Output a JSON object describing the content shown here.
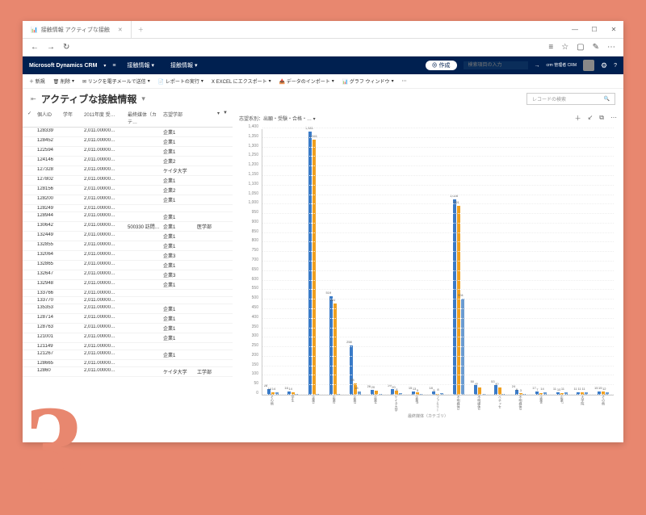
{
  "window": {
    "tab_title": "接触情報 アクティブな接触",
    "minimize": "—",
    "maximize": "☐",
    "close": "✕"
  },
  "addr": {
    "back": "←",
    "forward": "→",
    "reload": "↻",
    "hub": "≡",
    "star": "☆",
    "read": "▢",
    "edit": "✎",
    "more": "⋯"
  },
  "crm": {
    "logo": "Microsoft Dynamics CRM",
    "down": "▾",
    "menu": "≡",
    "nav1": "接触情報",
    "nav2": "接触情報",
    "create": "⊕ 作成",
    "search_ph": "検索項目の入力",
    "search_go": "→",
    "user": "crm 管理者\nCRM",
    "gear": "⚙",
    "help": "?"
  },
  "tb": {
    "new": "＋ 新規",
    "del": "🗑 削除",
    "elink": "✉ リンクを電子メールで送信",
    "report": "📄 レポートの実行",
    "excel": "Ⅹ EXCEL にエクスポート",
    "import": "📥 データのインポート",
    "chart": "📊 グラフ ウィンドウ",
    "more": "⋯"
  },
  "page": {
    "title": "アクティブな接触情報",
    "dd": "▾",
    "search_ph": "レコードの検索"
  },
  "cols": {
    "c1": "個人ID",
    "c2": "学年",
    "c3": "2011年度 受…",
    "c4": "最終媒体（カテ…",
    "c5": "志望学部",
    "dd": "▾",
    "filter": "▼"
  },
  "rows": [
    {
      "id": "128339",
      "y": "",
      "a": "2,011.00000…",
      "b": "",
      "m": "企業1",
      "d": ""
    },
    {
      "id": "128452",
      "y": "",
      "a": "2,011.00000…",
      "b": "",
      "m": "企業1",
      "d": ""
    },
    {
      "id": "122594",
      "y": "",
      "a": "2,011.00000…",
      "b": "",
      "m": "企業1",
      "d": ""
    },
    {
      "id": "124146",
      "y": "",
      "a": "2,011.00000…",
      "b": "",
      "m": "企業2",
      "d": ""
    },
    {
      "id": "127328",
      "y": "",
      "a": "2,011.00000…",
      "b": "",
      "m": "ケイタ大学",
      "d": ""
    },
    {
      "id": "127802",
      "y": "",
      "a": "2,011.00000…",
      "b": "",
      "m": "企業1",
      "d": ""
    },
    {
      "id": "128156",
      "y": "",
      "a": "2,011.00000…",
      "b": "",
      "m": "企業2",
      "d": ""
    },
    {
      "id": "128200",
      "y": "",
      "a": "2,011.00000…",
      "b": "",
      "m": "企業1",
      "d": ""
    },
    {
      "id": "128249",
      "y": "",
      "a": "2,011.00000…",
      "b": "",
      "m": "",
      "d": ""
    },
    {
      "id": "128944",
      "y": "",
      "a": "2,011.00000…",
      "b": "",
      "m": "企業1",
      "d": ""
    },
    {
      "id": "130642",
      "y": "",
      "a": "2,011.00000…",
      "b": "500330 訪問…",
      "m": "企業1",
      "d": "医学部"
    },
    {
      "id": "132449",
      "y": "",
      "a": "2,011.00000…",
      "b": "",
      "m": "企業1",
      "d": ""
    },
    {
      "id": "132855",
      "y": "",
      "a": "2,011.00000…",
      "b": "",
      "m": "企業1",
      "d": ""
    },
    {
      "id": "132064",
      "y": "",
      "a": "2,011.00000…",
      "b": "",
      "m": "企業3",
      "d": ""
    },
    {
      "id": "132865",
      "y": "",
      "a": "2,011.00000…",
      "b": "",
      "m": "企業1",
      "d": ""
    },
    {
      "id": "132647",
      "y": "",
      "a": "2,011.00000…",
      "b": "",
      "m": "企業3",
      "d": ""
    },
    {
      "id": "132948",
      "y": "",
      "a": "2,011.00000…",
      "b": "",
      "m": "企業1",
      "d": ""
    },
    {
      "id": "133766",
      "y": "",
      "a": "2,011.00000…",
      "b": "",
      "m": "",
      "d": ""
    },
    {
      "id": "133770",
      "y": "",
      "a": "2,011.00000…",
      "b": "",
      "m": "",
      "d": ""
    },
    {
      "id": "135353",
      "y": "",
      "a": "2,011.00000…",
      "b": "",
      "m": "企業1",
      "d": ""
    },
    {
      "id": "128714",
      "y": "",
      "a": "2,011.00000…",
      "b": "",
      "m": "企業1",
      "d": ""
    },
    {
      "id": "128763",
      "y": "",
      "a": "2,011.00000…",
      "b": "",
      "m": "企業1",
      "d": ""
    },
    {
      "id": "121001",
      "y": "",
      "a": "2,011.00000…",
      "b": "",
      "m": "企業1",
      "d": ""
    },
    {
      "id": "121149",
      "y": "",
      "a": "2,011.00000…",
      "b": "",
      "m": "",
      "d": ""
    },
    {
      "id": "121267",
      "y": "",
      "a": "2,011.00000…",
      "b": "",
      "m": "企業1",
      "d": ""
    },
    {
      "id": "128665",
      "y": "",
      "a": "2,011.00000…",
      "b": "",
      "m": "",
      "d": ""
    },
    {
      "id": "12860",
      "y": "",
      "a": "2,011.00000…",
      "b": "",
      "m": "ケイタ大学",
      "d": "工学部"
    }
  ],
  "chart_head": {
    "title": "志望系別：出願・受験・合格・… ▾",
    "i1": "＋",
    "i2": "↙",
    "i3": "⧉",
    "i4": "⋯"
  },
  "chart_data": {
    "type": "bar",
    "title": "志望系別：出願・受験・合格",
    "ylabel": "",
    "xlabel": "最終媒体（カテゴリ）",
    "ylim": [
      0,
      1400
    ],
    "yticks": [
      0,
      50,
      100,
      150,
      200,
      250,
      300,
      350,
      400,
      450,
      500,
      550,
      600,
      650,
      700,
      750,
      800,
      850,
      900,
      950,
      1000,
      1050,
      1100,
      1150,
      1200,
      1250,
      1300,
      1350,
      1400
    ],
    "categories": [
      "その他",
      "学生",
      "企業1",
      "企業2",
      "企業3",
      "企業4",
      "ケイタ大学",
      "企業5",
      "ファミリー",
      "不明媒体1",
      "不明媒体2",
      "ベネッセ",
      "不明媒体3",
      "企業6",
      "企業7",
      "大学院",
      "その他"
    ],
    "series": [
      {
        "name": "出願",
        "color": "#3a7bc8",
        "values": [
          28,
          16,
          1381,
          519,
          258,
          26,
          29,
          15,
          18,
          1028,
          50,
          53,
          24,
          17,
          11,
          11,
          15
        ]
      },
      {
        "name": "受験",
        "color": "#f0a020",
        "values": [
          14,
          14,
          1341,
          481,
          58,
          20,
          20,
          13,
          5,
          991,
          40,
          40,
          8,
          7,
          10,
          11,
          15
        ]
      },
      {
        "name": "合格",
        "color": "#6b9bd0",
        "values": [
          14,
          0,
          0,
          0,
          18,
          0,
          8,
          5,
          8,
          504,
          0,
          0,
          3,
          14,
          11,
          11,
          12
        ]
      }
    ]
  },
  "overlay": {
    "num": "3"
  }
}
